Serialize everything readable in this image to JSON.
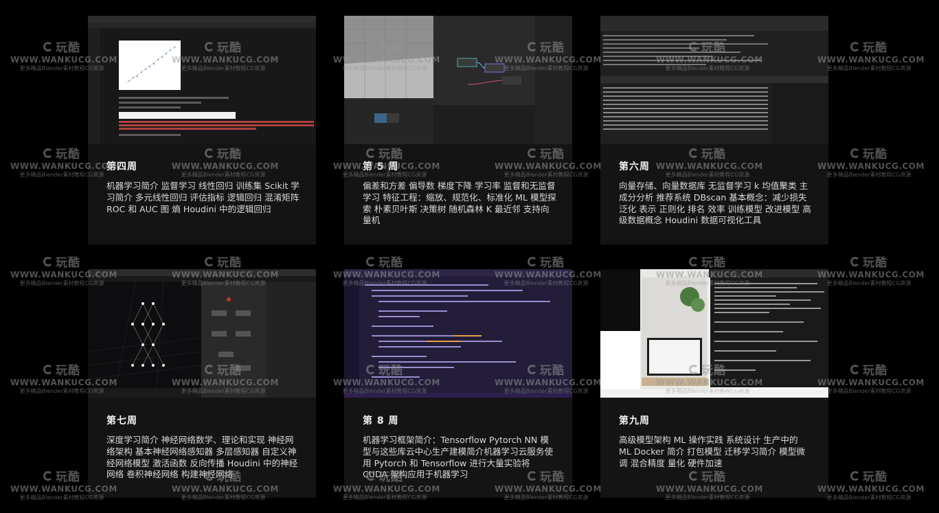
{
  "cards": [
    {
      "week": "第四周",
      "desc": "机器学习简介 监督学习 线性回归 训练集 Scikit 学习简介 多元线性回归 评估指标 逻辑回归 混淆矩阵 ROC 和 AUC 图 熵 Houdini 中的逻辑回归",
      "shot_type": "jupyter-notebook"
    },
    {
      "week": "第 5 周",
      "desc": "偏差和方差 偏导数 梯度下降 学习率 监督和无监督学习 特征工程：缩放、规范化、标准化 ML 模型探索 朴素贝叶斯 决策树 随机森林 K 最近邻 支持向量机",
      "shot_type": "houdini-node-graph"
    },
    {
      "week": "第六周",
      "desc": "向量存储、向量数据库 无监督学习 k 均值聚类 主成分分析 推荐系统 DBscan 基本概念：减少损失 泛化 表示 正则化 排名 效率 训练模型 改进模型 高级数据概念 Houdini 数据可视化工具",
      "shot_type": "spreadsheet-terminal"
    },
    {
      "week": "第七周",
      "desc": "深度学习简介 神经网络数学、理论和实现 神经网络架构 基本神经网络感知器 多层感知器 自定义神经网络模型 激活函数 反向传播 Houdini 中的神经网络 卷积神经网络 构建神经网络",
      "shot_type": "neural-network-viewport"
    },
    {
      "week": "第 8 周",
      "desc": "机器学习框架简介：Tensorflow Pytorch NN 模型与这些库云中心生产建模简介机器学习云服务使用 Pytorch 和 Tensorflow 进行大量实验将 CUDA 架构应用于机器学习",
      "shot_type": "code-editor"
    },
    {
      "week": "第九周",
      "desc": "高级模型架构 ML 操作实践 系统设计 生产中的 ML Docker 简介 打包模型 迁移学习简介 模型微调 混合精度 量化 硬件加速",
      "shot_type": "webcam-terminal"
    }
  ],
  "watermark": {
    "logo": "玩酷",
    "url": "WWW.WANKUCG.COM",
    "sub": "更多精品Blender素材教程CG资源"
  }
}
